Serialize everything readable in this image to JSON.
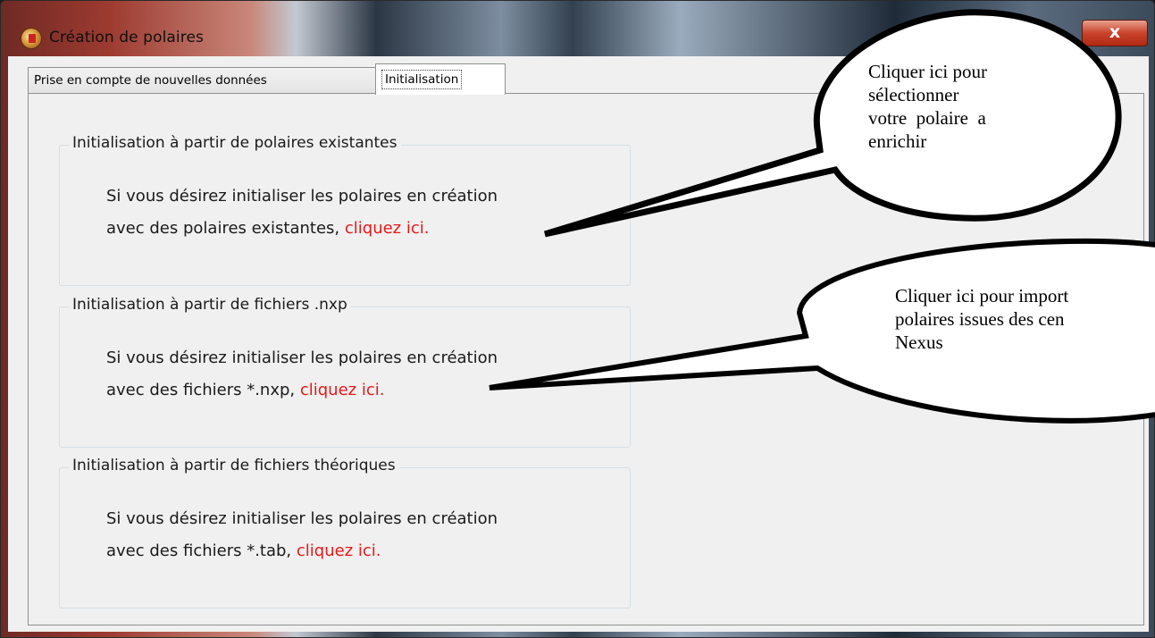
{
  "window": {
    "title": "Création de polaires",
    "close_glyph": "x",
    "colors": {
      "close": "#c9432b",
      "link": "#e8181a"
    }
  },
  "tabs": [
    {
      "label": "Prise en compte de nouvelles données",
      "active": false
    },
    {
      "label": "Initialisation",
      "active": true
    }
  ],
  "groups": [
    {
      "legend": "Initialisation à partir de polaires existantes",
      "line1": "Si vous désirez initialiser les polaires en création",
      "line2": "avec des polaires existantes,",
      "link": "cliquez ici."
    },
    {
      "legend": "Initialisation à partir de fichiers .nxp",
      "line1": "Si vous désirez initialiser les polaires en création",
      "line2": "avec des fichiers *.nxp,",
      "link": "cliquez ici."
    },
    {
      "legend": "Initialisation à partir de fichiers théoriques",
      "line1": "Si vous désirez initialiser les polaires en création",
      "line2": "avec des fichiers *.tab,",
      "link": "cliquez ici."
    }
  ],
  "callouts": [
    {
      "lines": [
        "Cliquer ici pour",
        "sélectionner",
        "votre  polaire  a",
        "enrichir"
      ]
    },
    {
      "lines": [
        "Cliquer ici pour import",
        "polaires issues des cen",
        "Nexus"
      ]
    }
  ]
}
